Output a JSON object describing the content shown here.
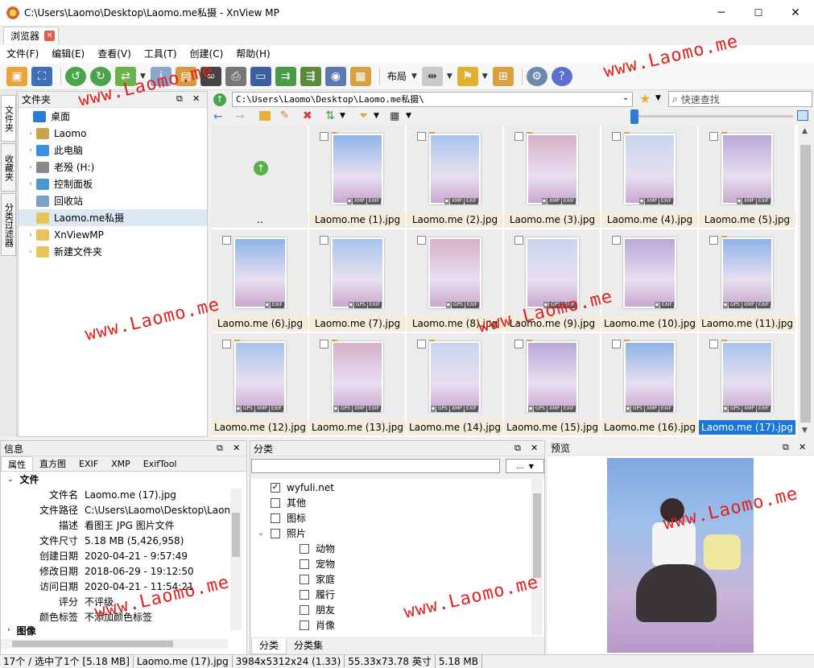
{
  "window": {
    "title": "C:\\Users\\Laomo\\Desktop\\Laomo.me私摄 - XnView MP",
    "minimize": "─",
    "maximize": "☐",
    "close": "✕"
  },
  "tab": {
    "label": "浏览器",
    "close": "✕"
  },
  "menu": [
    "文件(F)",
    "编辑(E)",
    "查看(V)",
    "工具(T)",
    "创建(C)",
    "帮助(H)"
  ],
  "toolbar": {
    "layout_label": "布局",
    "drop": "▼"
  },
  "sidetabs": [
    "文件夹",
    "收藏夹",
    "分类过滤器"
  ],
  "folder_panel": {
    "title": "文件夹",
    "items": [
      {
        "label": "桌面",
        "arrow": "",
        "indent": 0,
        "color": "#2f7ad4"
      },
      {
        "label": "Laomo",
        "arrow": "›",
        "indent": 1,
        "color": "#c9a24a"
      },
      {
        "label": "此电脑",
        "arrow": "›",
        "indent": 1,
        "color": "#3a8ee6"
      },
      {
        "label": "老殁 (H:)",
        "arrow": "›",
        "indent": 1,
        "color": "#888888"
      },
      {
        "label": "控制面板",
        "arrow": "›",
        "indent": 1,
        "color": "#4a9ad0"
      },
      {
        "label": "回收站",
        "arrow": "",
        "indent": 1,
        "color": "#7aa0c8"
      },
      {
        "label": "Laomo.me私摄",
        "arrow": "",
        "indent": 1,
        "color": "#e8c25a"
      },
      {
        "label": "XnViewMP",
        "arrow": "›",
        "indent": 1,
        "color": "#e8c25a"
      },
      {
        "label": "新建文件夹",
        "arrow": "›",
        "indent": 1,
        "color": "#e8c25a"
      }
    ]
  },
  "address": {
    "path": "C:\\Users\\Laomo\\Desktop\\Laomo.me私摄\\",
    "search_placeholder": "快速查找"
  },
  "thumbnails": {
    "parent_label": "..",
    "items": [
      {
        "name": "Laomo.me (1).jpg",
        "badges": [
          "XMP",
          "EXIF"
        ],
        "portrait": true
      },
      {
        "name": "Laomo.me (2).jpg",
        "badges": [
          "XMP",
          "EXIF"
        ],
        "portrait": true
      },
      {
        "name": "Laomo.me (3).jpg",
        "badges": [
          "XMP",
          "EXIF"
        ],
        "portrait": true
      },
      {
        "name": "Laomo.me (4).jpg",
        "badges": [
          "XMP",
          "EXIF"
        ],
        "portrait": true
      },
      {
        "name": "Laomo.me (5).jpg",
        "badges": [
          "XMP",
          "EXIF"
        ],
        "portrait": true
      },
      {
        "name": "Laomo.me (6).jpg",
        "badges": [
          "EXIF"
        ],
        "portrait": false
      },
      {
        "name": "Laomo.me (7).jpg",
        "badges": [
          "GPS",
          "EXIF"
        ],
        "portrait": false
      },
      {
        "name": "Laomo.me (8).jpg",
        "badges": [
          "GPS",
          "EXIF"
        ],
        "portrait": false
      },
      {
        "name": "Laomo.me (9).jpg",
        "badges": [
          "GPS",
          "EXIF"
        ],
        "portrait": false
      },
      {
        "name": "Laomo.me (10).jpg",
        "badges": [
          "EXIF"
        ],
        "portrait": false
      },
      {
        "name": "Laomo.me (11).jpg",
        "badges": [
          "GPS",
          "XMP",
          "EXIF"
        ],
        "portrait": true
      },
      {
        "name": "Laomo.me (12).jpg",
        "badges": [
          "GPS",
          "XMP",
          "EXIF"
        ],
        "portrait": true
      },
      {
        "name": "Laomo.me (13).jpg",
        "badges": [
          "GPS",
          "XMP",
          "EXIF"
        ],
        "portrait": true
      },
      {
        "name": "Laomo.me (14).jpg",
        "badges": [
          "GPS",
          "XMP",
          "EXIF"
        ],
        "portrait": true
      },
      {
        "name": "Laomo.me (15).jpg",
        "badges": [
          "GPS",
          "XMP",
          "EXIF"
        ],
        "portrait": true
      },
      {
        "name": "Laomo.me (16).jpg",
        "badges": [
          "GPS",
          "XMP",
          "EXIF"
        ],
        "portrait": true
      },
      {
        "name": "Laomo.me (17).jpg",
        "badges": [
          "GPS",
          "XMP",
          "EXIF"
        ],
        "portrait": true,
        "selected": true
      }
    ]
  },
  "info_panel": {
    "title": "信息",
    "tabs": [
      "属性",
      "直方图",
      "EXIF",
      "XMP",
      "ExifTool"
    ],
    "section": "文件",
    "next_section": "图像",
    "rows": [
      {
        "k": "文件名",
        "v": "Laomo.me (17).jpg"
      },
      {
        "k": "文件路径",
        "v": "C:\\Users\\Laomo\\Desktop\\Laon"
      },
      {
        "k": "描述",
        "v": "看图王 JPG 图片文件"
      },
      {
        "k": "文件尺寸",
        "v": "5.18 MB (5,426,958)"
      },
      {
        "k": "创建日期",
        "v": "2020-04-21 - 9:57:49"
      },
      {
        "k": "修改日期",
        "v": "2018-06-29 - 19:12:50"
      },
      {
        "k": "访问日期",
        "v": "2020-04-21 - 11:54:21"
      },
      {
        "k": "评分",
        "v": "不评级"
      },
      {
        "k": "颜色标签",
        "v": "不添加颜色标签"
      }
    ]
  },
  "category_panel": {
    "title": "分类",
    "more_button": "...",
    "tabs": [
      "分类",
      "分类集"
    ],
    "items": [
      {
        "label": "wyfuli.net",
        "checked": true,
        "indent": 0,
        "expand": ""
      },
      {
        "label": "其他",
        "checked": false,
        "indent": 0,
        "expand": ""
      },
      {
        "label": "图标",
        "checked": false,
        "indent": 0,
        "expand": ""
      },
      {
        "label": "照片",
        "checked": false,
        "indent": 0,
        "expand": "⌄"
      },
      {
        "label": "动物",
        "checked": false,
        "indent": 1,
        "expand": ""
      },
      {
        "label": "宠物",
        "checked": false,
        "indent": 1,
        "expand": ""
      },
      {
        "label": "家庭",
        "checked": false,
        "indent": 1,
        "expand": ""
      },
      {
        "label": "履行",
        "checked": false,
        "indent": 1,
        "expand": ""
      },
      {
        "label": "朋友",
        "checked": false,
        "indent": 1,
        "expand": ""
      },
      {
        "label": "肖像",
        "checked": false,
        "indent": 1,
        "expand": ""
      }
    ]
  },
  "preview_panel": {
    "title": "预览"
  },
  "status": [
    "17个 / 选中了1个 [5.18 MB]",
    "Laomo.me (17).jpg",
    "3984x5312x24 (1.33)",
    "55.33x73.78 英寸",
    "5.18 MB"
  ],
  "watermark": "www.Laomo.me",
  "panel_controls": {
    "float": "⧉",
    "close": "✕"
  }
}
